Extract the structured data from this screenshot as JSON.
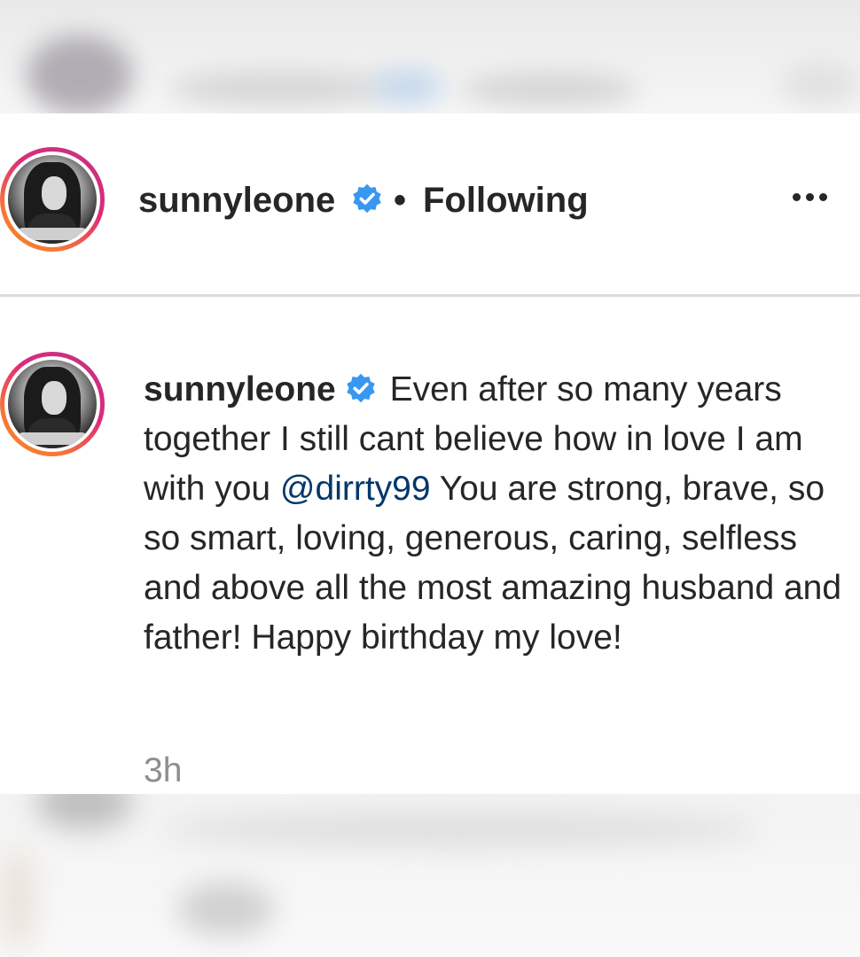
{
  "post": {
    "username": "sunnyleone",
    "separator": "•",
    "follow_status": "Following",
    "caption": {
      "username": "sunnyleone",
      "text_before": "Even after so many years together I still cant believe how in love I am with you",
      "mention": "@dirrty99",
      "text_after": "You are strong, brave, so so smart, loving, generous, caring, selfless and above all the most amazing husband and father! Happy birthday my love!"
    },
    "timestamp": "3h"
  },
  "icons": {
    "verified": "verified-badge-icon",
    "more": "more-options-icon"
  },
  "colors": {
    "verified_blue": "#3897f0",
    "mention_blue": "#00376b",
    "text": "#262626",
    "muted": "#8e8e8e"
  }
}
